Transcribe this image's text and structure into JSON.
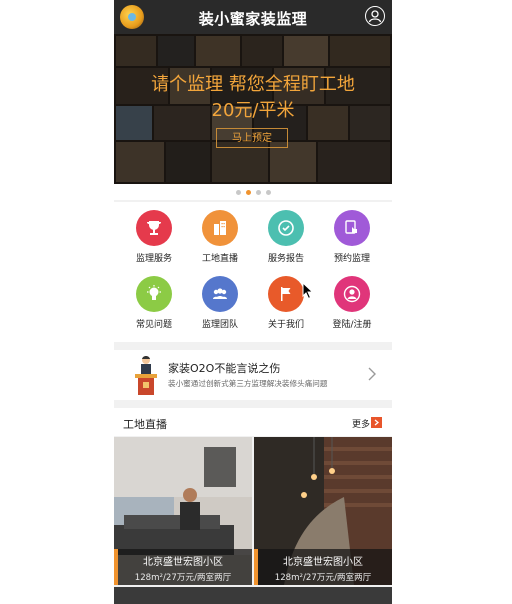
{
  "header": {
    "title": "装小蜜家装监理",
    "logo_icon": "bee-logo-icon",
    "user_icon": "user-avatar-icon"
  },
  "banner": {
    "headline": "请个监理 帮您全程盯工地",
    "price": "20元/平米",
    "button": "马上预定",
    "slides_total": 4,
    "slide_active": 2
  },
  "menu": [
    {
      "label": "监理服务",
      "color": "#e53a4c",
      "icon": "trophy-icon"
    },
    {
      "label": "工地直播",
      "color": "#f0923a",
      "icon": "buildings-icon"
    },
    {
      "label": "服务报告",
      "color": "#4cbfb0",
      "icon": "report-icon"
    },
    {
      "label": "预约监理",
      "color": "#a05ad8",
      "icon": "touch-icon"
    },
    {
      "label": "常见问题",
      "color": "#8ccb45",
      "icon": "lightbulb-icon"
    },
    {
      "label": "监理团队",
      "color": "#5577cc",
      "icon": "team-icon"
    },
    {
      "label": "关于我们",
      "color": "#e85a2a",
      "icon": "flag-icon"
    },
    {
      "label": "登陆/注册",
      "color": "#e0357a",
      "icon": "person-icon"
    }
  ],
  "news": {
    "title": "家装O2O不能言说之伤",
    "subtitle": "装小蜜通过创新式第三方监理解决装修头痛问题"
  },
  "live": {
    "section_title": "工地直播",
    "more_label": "更多",
    "cards": [
      {
        "name": "北京盛世宏图小区",
        "info": "128m²/27万元/两室两厅"
      },
      {
        "name": "北京盛世宏图小区",
        "info": "128m²/27万元/两室两厅"
      }
    ]
  },
  "colors": {
    "accent": "#f0932e",
    "banner_text": "#f2a53b",
    "header_bg": "#2a2a2a"
  }
}
